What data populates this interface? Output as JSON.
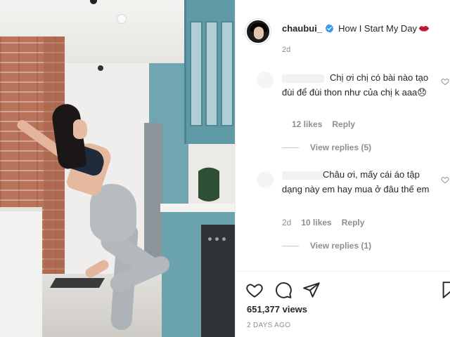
{
  "post": {
    "username": "chaubui_",
    "caption": "How I Start My Day",
    "caption_emoji": "lips-icon",
    "caption_age": "2d",
    "verified": true
  },
  "comments": [
    {
      "text": "Chị ơi chị có bài nào tạo đùi để đùi thon như của chị k aaa😞",
      "age": "",
      "likes": "12 likes",
      "reply_label": "Reply",
      "view_replies": "View replies (5)"
    },
    {
      "text": "Châu ơi, mấy cái áo tập dạng này em hay mua ở đâu thế em",
      "age": "2d",
      "likes": "10 likes",
      "reply_label": "Reply",
      "view_replies": "View replies (1)"
    }
  ],
  "stats": {
    "views": "651,377 views",
    "posted": "2 DAYS AGO"
  },
  "icons": {
    "like": "heart-icon",
    "comment": "comment-bubble-icon",
    "share": "paper-plane-icon",
    "save": "bookmark-icon",
    "verified": "verified-badge-icon"
  },
  "colors": {
    "verified": "#3897f0",
    "lips": "#c0223b",
    "text": "#262626",
    "muted": "#8e8e8e"
  }
}
